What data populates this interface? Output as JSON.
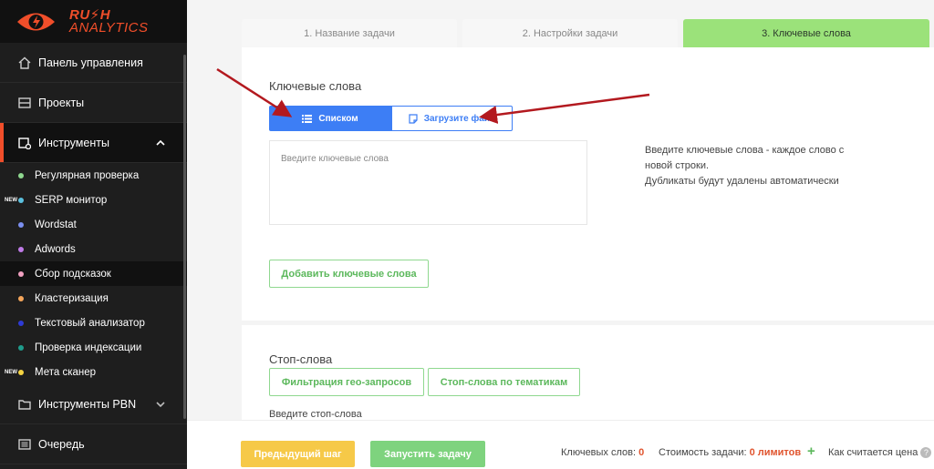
{
  "logo": {
    "line1": "RU⚡H",
    "line2": "ANALYTICS"
  },
  "sidebar": {
    "items": [
      {
        "label": "Панель управления"
      },
      {
        "label": "Проекты"
      },
      {
        "label": "Инструменты"
      }
    ],
    "subitems": [
      {
        "label": "Регулярная проверка",
        "color": "#8fd88f"
      },
      {
        "label": "SERP монитор",
        "color": "#5bc0de",
        "badge": "NEW"
      },
      {
        "label": "Wordstat",
        "color": "#7b8ff0"
      },
      {
        "label": "Adwords",
        "color": "#c07be8"
      },
      {
        "label": "Сбор подсказок",
        "color": "#f0a0c0"
      },
      {
        "label": "Кластеризация",
        "color": "#f5a65b"
      },
      {
        "label": "Текстовый анализатор",
        "color": "#2e3bd6"
      },
      {
        "label": "Проверка индексации",
        "color": "#1f9c8c"
      },
      {
        "label": "Мета сканер",
        "color": "#f5d442",
        "badge": "NEW"
      }
    ],
    "bottom_items": [
      {
        "label": "Инструменты PBN"
      },
      {
        "label": "Очередь"
      }
    ]
  },
  "tabs": [
    {
      "label": "1. Название задачи"
    },
    {
      "label": "2. Настройки задачи"
    },
    {
      "label": "3. Ключевые слова"
    }
  ],
  "keywords": {
    "title": "Ключевые слова",
    "btn_list": "Списком",
    "btn_file": "Загрузите файл",
    "placeholder": "Введите ключевые слова",
    "hint_line1": "Введите ключевые слова - каждое слово с",
    "hint_line2": "новой строки.",
    "hint_line3": "Дубликаты будут удалены автоматически",
    "add_button": "Добавить ключевые слова"
  },
  "stopwords": {
    "title": "Стоп-слова",
    "btn_geo": "Фильтрация гео-запросов",
    "btn_topics": "Стоп-слова по тематикам",
    "prompt": "Введите стоп-слова"
  },
  "footer": {
    "prev": "Предыдущий шаг",
    "start": "Запустить задачу",
    "keywords_label": "Ключевых слов:",
    "keywords_count": "0",
    "cost_label": "Стоимость задачи:",
    "cost_value": "0 лимитов",
    "how_label": "Как считается цена"
  },
  "colors": {
    "accent": "#f04e2a",
    "blue": "#3d7ef5",
    "green": "#9be27a",
    "annotation_arrow": "#b3191f"
  }
}
